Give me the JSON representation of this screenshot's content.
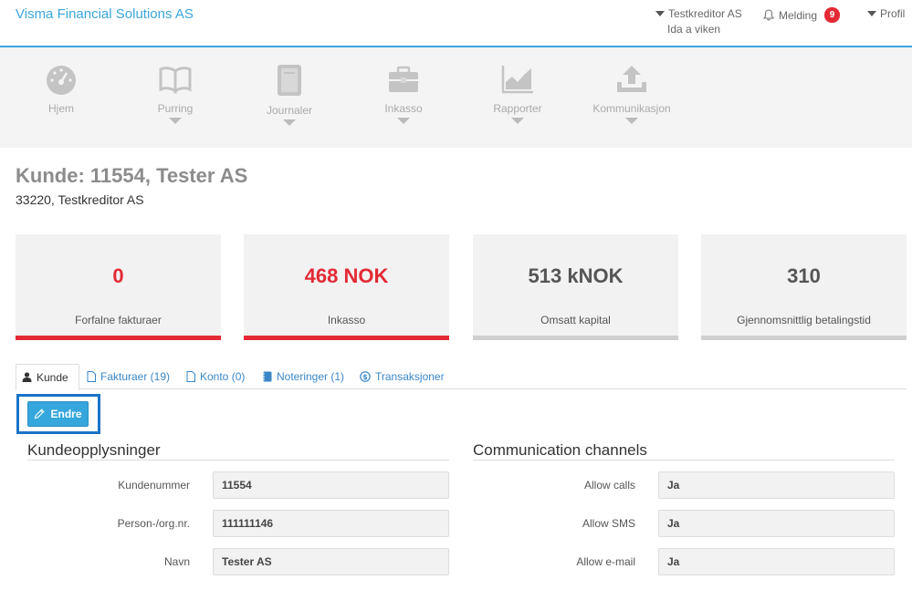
{
  "brand": "Visma Financial Solutions AS",
  "topnav": {
    "creditor": "Testkreditor AS",
    "user": "Ida a viken",
    "melding": "Melding",
    "melding_count": "9",
    "profil": "Profil"
  },
  "nav": [
    {
      "label": "Hjem",
      "icon": "dashboard-icon"
    },
    {
      "label": "Purring",
      "icon": "book-icon"
    },
    {
      "label": "Journaler",
      "icon": "journal-icon"
    },
    {
      "label": "Inkasso",
      "icon": "briefcase-icon"
    },
    {
      "label": "Rapporter",
      "icon": "area-chart-icon"
    },
    {
      "label": "Kommunikasjon",
      "icon": "upload-icon"
    }
  ],
  "header": {
    "title": "Kunde: 11554, Tester AS",
    "subtitle": "33220, Testkreditor AS"
  },
  "kpis": [
    {
      "value": "0",
      "label": "Forfalne fakturaer",
      "status": "red"
    },
    {
      "value": "468 NOK",
      "label": "Inkasso",
      "status": "red"
    },
    {
      "value": "513 kNOK",
      "label": "Omsatt kapital",
      "status": "grey"
    },
    {
      "value": "310",
      "label": "Gjennomsnittlig betalingstid",
      "status": "grey"
    }
  ],
  "tabs": [
    {
      "label": "Kunde",
      "icon": "user-icon",
      "active": true
    },
    {
      "label": "Fakturaer (19)",
      "icon": "file-icon"
    },
    {
      "label": "Konto (0)",
      "icon": "file-icon"
    },
    {
      "label": "Noteringer (1)",
      "icon": "notebook-icon"
    },
    {
      "label": "Transaksjoner",
      "icon": "dollar-icon"
    }
  ],
  "edit_button": "Endre",
  "customer_info": {
    "title": "Kundeopplysninger",
    "fields": [
      {
        "label": "Kundenummer",
        "value": "11554"
      },
      {
        "label": "Person-/org.nr.",
        "value": "111111146"
      },
      {
        "label": "Navn",
        "value": "Tester AS"
      }
    ]
  },
  "channels": {
    "title": "Communication channels",
    "fields": [
      {
        "label": "Allow calls",
        "value": "Ja"
      },
      {
        "label": "Allow SMS",
        "value": "Ja"
      },
      {
        "label": "Allow e-mail",
        "value": "Ja"
      }
    ]
  },
  "colors": {
    "accent": "#3aa6dd",
    "danger": "#e32a35",
    "button": "#35a7dd",
    "highlight_frame": "#1a73c8"
  }
}
